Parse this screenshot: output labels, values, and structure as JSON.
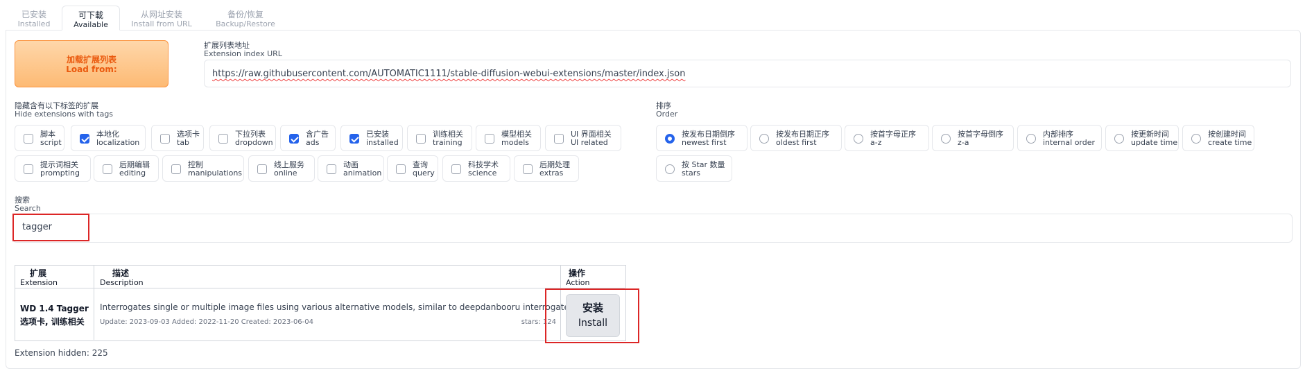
{
  "tabs": [
    {
      "zh": "已安装",
      "en": "Installed"
    },
    {
      "zh": "可下載",
      "en": "Available"
    },
    {
      "zh": "从网址安装",
      "en": "Install from URL"
    },
    {
      "zh": "备份/恢复",
      "en": "Backup/Restore"
    }
  ],
  "load": {
    "zh": "加载扩展列表",
    "en": "Load from:"
  },
  "index_url": {
    "zh": "扩展列表地址",
    "en": "Extension index URL",
    "value": "https://raw.githubusercontent.com/AUTOMATIC1111/stable-diffusion-webui-extensions/master/index.json"
  },
  "hide_tags": {
    "zh": "隐藏含有以下标签的扩展",
    "en": "Hide extensions with tags",
    "items": [
      {
        "zh": "脚本",
        "en": "script",
        "checked": false
      },
      {
        "zh": "本地化",
        "en": "localization",
        "checked": true
      },
      {
        "zh": "选项卡",
        "en": "tab",
        "checked": false
      },
      {
        "zh": "下拉列表",
        "en": "dropdown",
        "checked": false
      },
      {
        "zh": "含广告",
        "en": "ads",
        "checked": true
      },
      {
        "zh": "已安装",
        "en": "installed",
        "checked": true
      },
      {
        "zh": "训练相关",
        "en": "training",
        "checked": false
      },
      {
        "zh": "模型相关",
        "en": "models",
        "checked": false
      },
      {
        "zh": "UI 界面相关",
        "en": "UI related",
        "checked": false
      },
      {
        "zh": "提示词相关",
        "en": "prompting",
        "checked": false
      },
      {
        "zh": "后期编辑",
        "en": "editing",
        "checked": false
      },
      {
        "zh": "控制",
        "en": "manipulations",
        "checked": false
      },
      {
        "zh": "线上服务",
        "en": "online",
        "checked": false
      },
      {
        "zh": "动画",
        "en": "animation",
        "checked": false
      },
      {
        "zh": "查询",
        "en": "query",
        "checked": false
      },
      {
        "zh": "科技学术",
        "en": "science",
        "checked": false
      },
      {
        "zh": "后期处理",
        "en": "extras",
        "checked": false
      }
    ]
  },
  "order": {
    "zh": "排序",
    "en": "Order",
    "items": [
      {
        "zh": "按发布日期倒序",
        "en": "newest first",
        "selected": true
      },
      {
        "zh": "按发布日期正序",
        "en": "oldest first",
        "selected": false
      },
      {
        "zh": "按首字母正序",
        "en": "a-z",
        "selected": false
      },
      {
        "zh": "按首字母倒序",
        "en": "z-a",
        "selected": false
      },
      {
        "zh": "内部排序",
        "en": "internal order",
        "selected": false
      },
      {
        "zh": "按更新时间",
        "en": "update time",
        "selected": false
      },
      {
        "zh": "按创建时间",
        "en": "create time",
        "selected": false
      },
      {
        "zh": "按 Star 数量",
        "en": "stars",
        "selected": false
      }
    ]
  },
  "search": {
    "zh": "搜索",
    "en": "Search",
    "value": "tagger"
  },
  "table": {
    "headers": [
      {
        "zh": "扩展",
        "en": "Extension"
      },
      {
        "zh": "描述",
        "en": "Description"
      },
      {
        "zh": "操作",
        "en": "Action"
      }
    ],
    "row": {
      "name": "WD 1.4 Tagger",
      "tags": "选项卡, 训练相关",
      "description": "Interrogates single or multiple image files using various alternative models, similar to deepdanbooru interrogate.",
      "dates": "Update: 2023-09-03 Added: 2022-11-20 Created: 2023-06-04",
      "stars": "stars: 124",
      "action_zh": "安装",
      "action_en": "Install"
    }
  },
  "hidden_count": "Extension hidden: 225"
}
